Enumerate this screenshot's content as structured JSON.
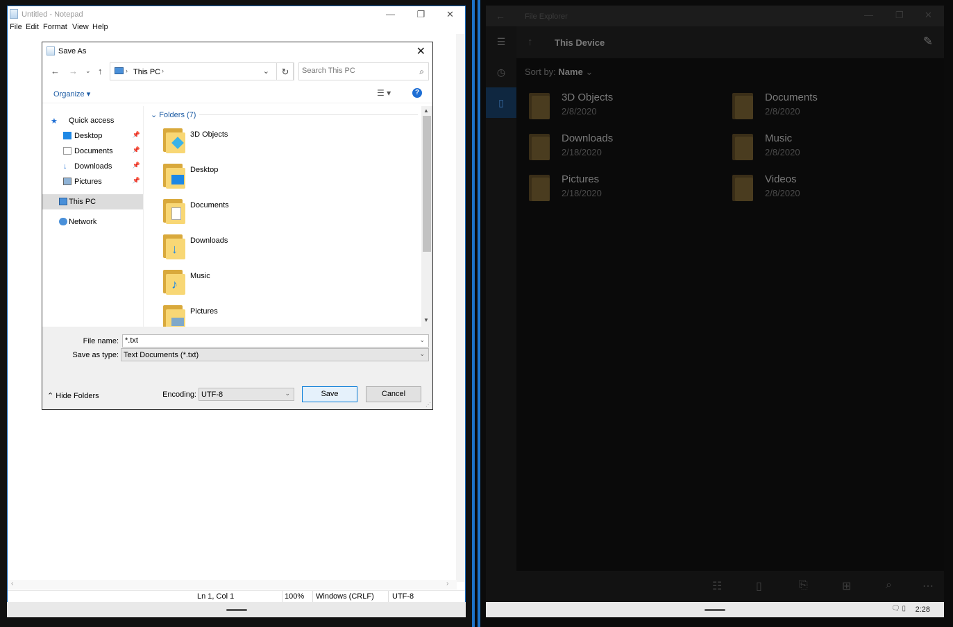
{
  "notepad": {
    "title": "Untitled - Notepad",
    "menu": [
      "File",
      "Edit",
      "Format",
      "View",
      "Help"
    ],
    "status": {
      "position": "Ln 1, Col 1",
      "zoom": "100%",
      "line_endings": "Windows (CRLF)",
      "encoding": "UTF-8"
    }
  },
  "dialog": {
    "title": "Save As",
    "breadcrumb": "This PC",
    "search_placeholder": "Search This PC",
    "organize": "Organize",
    "nav": {
      "quick_access": "Quick access",
      "items": [
        "Desktop",
        "Documents",
        "Downloads",
        "Pictures"
      ],
      "this_pc": "This PC",
      "network": "Network"
    },
    "group_header": "Folders (7)",
    "folders": [
      "3D Objects",
      "Desktop",
      "Documents",
      "Downloads",
      "Music",
      "Pictures"
    ],
    "file_name_label": "File name:",
    "file_name_value": "*.txt",
    "save_type_label": "Save as type:",
    "save_type_value": "Text Documents (*.txt)",
    "hide_folders": "Hide Folders",
    "encoding_label": "Encoding:",
    "encoding_value": "UTF-8",
    "save": "Save",
    "cancel": "Cancel"
  },
  "file_explorer": {
    "title": "File Explorer",
    "header": "This Device",
    "sort_label": "Sort by:",
    "sort_value": "Name",
    "items": [
      {
        "name": "3D Objects",
        "date": "2/8/2020"
      },
      {
        "name": "Documents",
        "date": "2/8/2020"
      },
      {
        "name": "Downloads",
        "date": "2/18/2020"
      },
      {
        "name": "Music",
        "date": "2/8/2020"
      },
      {
        "name": "Pictures",
        "date": "2/18/2020"
      },
      {
        "name": "Videos",
        "date": "2/8/2020"
      }
    ]
  },
  "taskbar": {
    "time": "2:28"
  },
  "colors": {
    "accent": "#1d73c9",
    "folder": "#f8d775",
    "link": "#1a5aa3"
  }
}
